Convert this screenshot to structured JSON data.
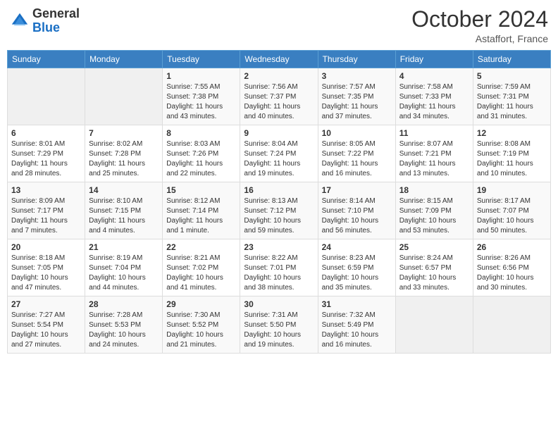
{
  "header": {
    "logo_general": "General",
    "logo_blue": "Blue",
    "month_year": "October 2024",
    "location": "Astaffort, France"
  },
  "days_of_week": [
    "Sunday",
    "Monday",
    "Tuesday",
    "Wednesday",
    "Thursday",
    "Friday",
    "Saturday"
  ],
  "weeks": [
    [
      {
        "num": "",
        "empty": true
      },
      {
        "num": "",
        "empty": true
      },
      {
        "num": "1",
        "sunrise": "Sunrise: 7:55 AM",
        "sunset": "Sunset: 7:38 PM",
        "daylight": "Daylight: 11 hours and 43 minutes."
      },
      {
        "num": "2",
        "sunrise": "Sunrise: 7:56 AM",
        "sunset": "Sunset: 7:37 PM",
        "daylight": "Daylight: 11 hours and 40 minutes."
      },
      {
        "num": "3",
        "sunrise": "Sunrise: 7:57 AM",
        "sunset": "Sunset: 7:35 PM",
        "daylight": "Daylight: 11 hours and 37 minutes."
      },
      {
        "num": "4",
        "sunrise": "Sunrise: 7:58 AM",
        "sunset": "Sunset: 7:33 PM",
        "daylight": "Daylight: 11 hours and 34 minutes."
      },
      {
        "num": "5",
        "sunrise": "Sunrise: 7:59 AM",
        "sunset": "Sunset: 7:31 PM",
        "daylight": "Daylight: 11 hours and 31 minutes."
      }
    ],
    [
      {
        "num": "6",
        "sunrise": "Sunrise: 8:01 AM",
        "sunset": "Sunset: 7:29 PM",
        "daylight": "Daylight: 11 hours and 28 minutes."
      },
      {
        "num": "7",
        "sunrise": "Sunrise: 8:02 AM",
        "sunset": "Sunset: 7:28 PM",
        "daylight": "Daylight: 11 hours and 25 minutes."
      },
      {
        "num": "8",
        "sunrise": "Sunrise: 8:03 AM",
        "sunset": "Sunset: 7:26 PM",
        "daylight": "Daylight: 11 hours and 22 minutes."
      },
      {
        "num": "9",
        "sunrise": "Sunrise: 8:04 AM",
        "sunset": "Sunset: 7:24 PM",
        "daylight": "Daylight: 11 hours and 19 minutes."
      },
      {
        "num": "10",
        "sunrise": "Sunrise: 8:05 AM",
        "sunset": "Sunset: 7:22 PM",
        "daylight": "Daylight: 11 hours and 16 minutes."
      },
      {
        "num": "11",
        "sunrise": "Sunrise: 8:07 AM",
        "sunset": "Sunset: 7:21 PM",
        "daylight": "Daylight: 11 hours and 13 minutes."
      },
      {
        "num": "12",
        "sunrise": "Sunrise: 8:08 AM",
        "sunset": "Sunset: 7:19 PM",
        "daylight": "Daylight: 11 hours and 10 minutes."
      }
    ],
    [
      {
        "num": "13",
        "sunrise": "Sunrise: 8:09 AM",
        "sunset": "Sunset: 7:17 PM",
        "daylight": "Daylight: 11 hours and 7 minutes."
      },
      {
        "num": "14",
        "sunrise": "Sunrise: 8:10 AM",
        "sunset": "Sunset: 7:15 PM",
        "daylight": "Daylight: 11 hours and 4 minutes."
      },
      {
        "num": "15",
        "sunrise": "Sunrise: 8:12 AM",
        "sunset": "Sunset: 7:14 PM",
        "daylight": "Daylight: 11 hours and 1 minute."
      },
      {
        "num": "16",
        "sunrise": "Sunrise: 8:13 AM",
        "sunset": "Sunset: 7:12 PM",
        "daylight": "Daylight: 10 hours and 59 minutes."
      },
      {
        "num": "17",
        "sunrise": "Sunrise: 8:14 AM",
        "sunset": "Sunset: 7:10 PM",
        "daylight": "Daylight: 10 hours and 56 minutes."
      },
      {
        "num": "18",
        "sunrise": "Sunrise: 8:15 AM",
        "sunset": "Sunset: 7:09 PM",
        "daylight": "Daylight: 10 hours and 53 minutes."
      },
      {
        "num": "19",
        "sunrise": "Sunrise: 8:17 AM",
        "sunset": "Sunset: 7:07 PM",
        "daylight": "Daylight: 10 hours and 50 minutes."
      }
    ],
    [
      {
        "num": "20",
        "sunrise": "Sunrise: 8:18 AM",
        "sunset": "Sunset: 7:05 PM",
        "daylight": "Daylight: 10 hours and 47 minutes."
      },
      {
        "num": "21",
        "sunrise": "Sunrise: 8:19 AM",
        "sunset": "Sunset: 7:04 PM",
        "daylight": "Daylight: 10 hours and 44 minutes."
      },
      {
        "num": "22",
        "sunrise": "Sunrise: 8:21 AM",
        "sunset": "Sunset: 7:02 PM",
        "daylight": "Daylight: 10 hours and 41 minutes."
      },
      {
        "num": "23",
        "sunrise": "Sunrise: 8:22 AM",
        "sunset": "Sunset: 7:01 PM",
        "daylight": "Daylight: 10 hours and 38 minutes."
      },
      {
        "num": "24",
        "sunrise": "Sunrise: 8:23 AM",
        "sunset": "Sunset: 6:59 PM",
        "daylight": "Daylight: 10 hours and 35 minutes."
      },
      {
        "num": "25",
        "sunrise": "Sunrise: 8:24 AM",
        "sunset": "Sunset: 6:57 PM",
        "daylight": "Daylight: 10 hours and 33 minutes."
      },
      {
        "num": "26",
        "sunrise": "Sunrise: 8:26 AM",
        "sunset": "Sunset: 6:56 PM",
        "daylight": "Daylight: 10 hours and 30 minutes."
      }
    ],
    [
      {
        "num": "27",
        "sunrise": "Sunrise: 7:27 AM",
        "sunset": "Sunset: 5:54 PM",
        "daylight": "Daylight: 10 hours and 27 minutes."
      },
      {
        "num": "28",
        "sunrise": "Sunrise: 7:28 AM",
        "sunset": "Sunset: 5:53 PM",
        "daylight": "Daylight: 10 hours and 24 minutes."
      },
      {
        "num": "29",
        "sunrise": "Sunrise: 7:30 AM",
        "sunset": "Sunset: 5:52 PM",
        "daylight": "Daylight: 10 hours and 21 minutes."
      },
      {
        "num": "30",
        "sunrise": "Sunrise: 7:31 AM",
        "sunset": "Sunset: 5:50 PM",
        "daylight": "Daylight: 10 hours and 19 minutes."
      },
      {
        "num": "31",
        "sunrise": "Sunrise: 7:32 AM",
        "sunset": "Sunset: 5:49 PM",
        "daylight": "Daylight: 10 hours and 16 minutes."
      },
      {
        "num": "",
        "empty": true
      },
      {
        "num": "",
        "empty": true
      }
    ]
  ]
}
